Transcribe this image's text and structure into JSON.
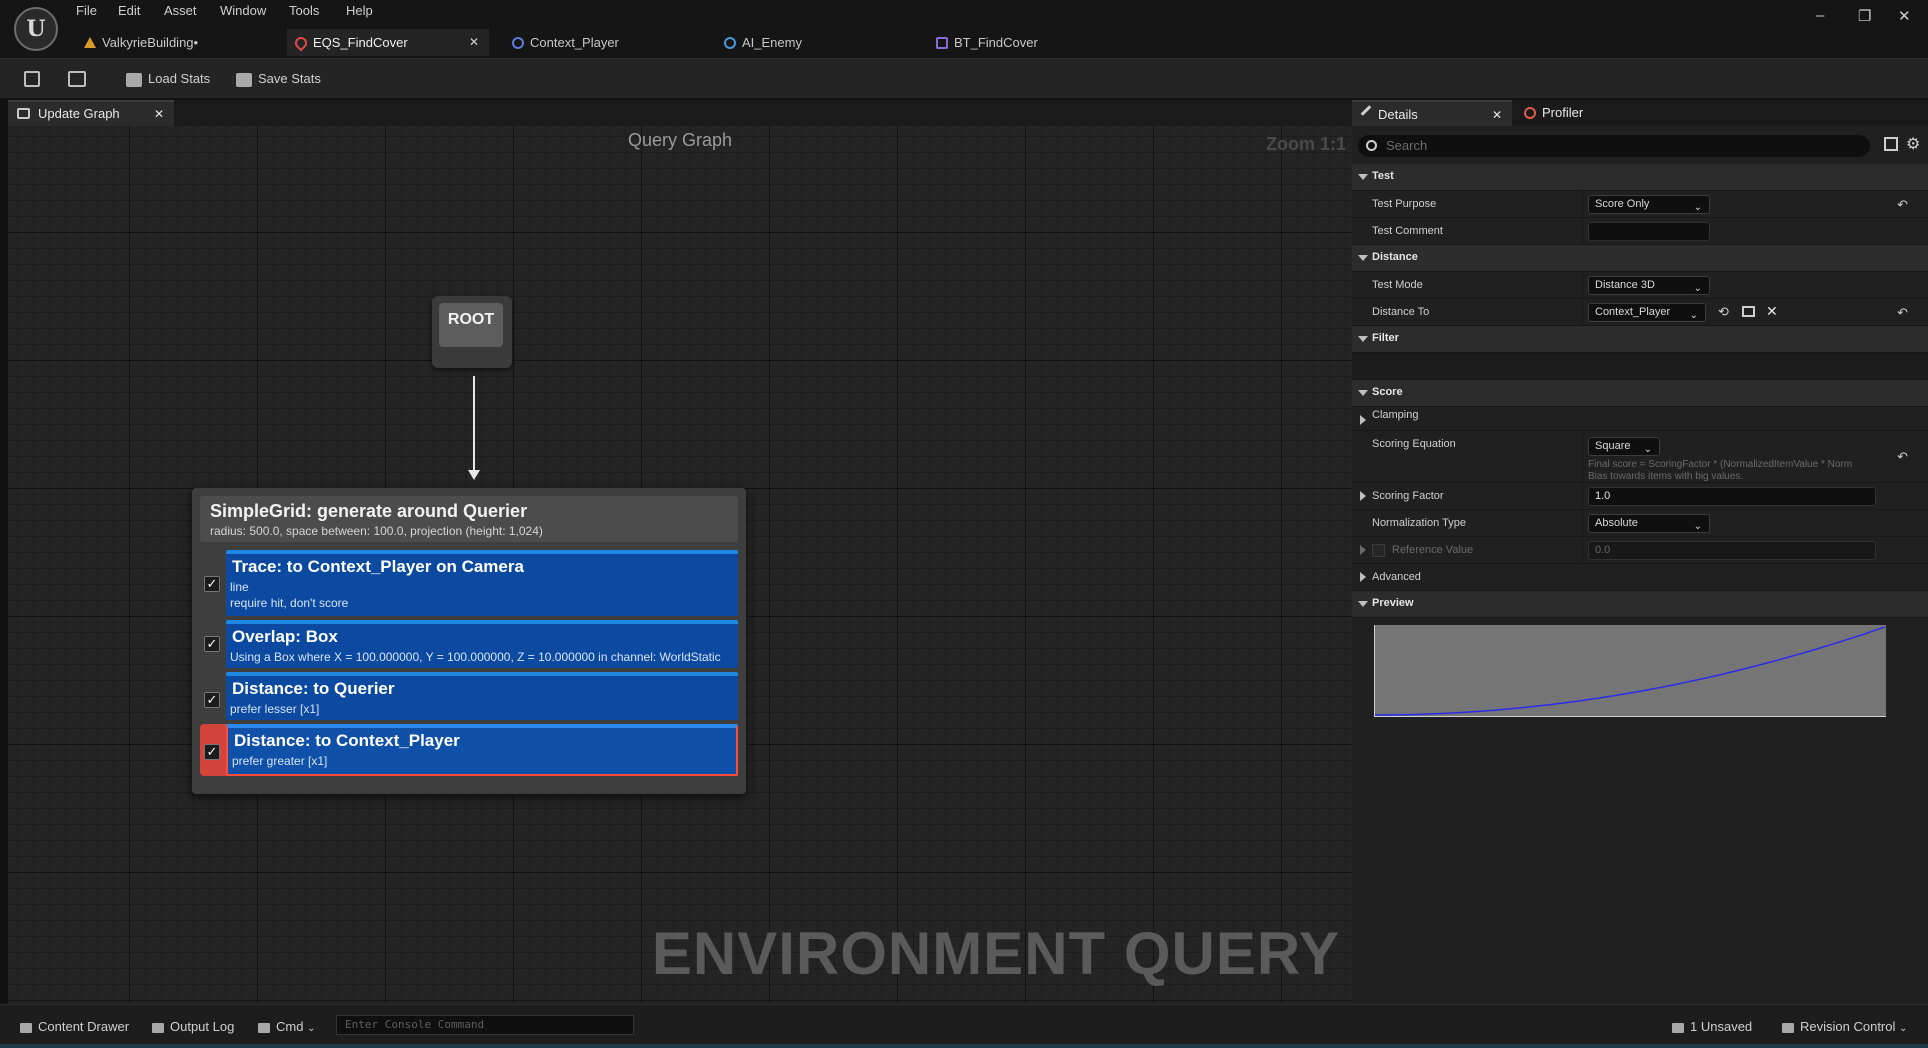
{
  "menu": [
    "File",
    "Edit",
    "Asset",
    "Window",
    "Tools",
    "Help"
  ],
  "doc_tabs": [
    {
      "label": "ValkyrieBuilding•",
      "icon": "level-icon",
      "color": "#d89a2c"
    },
    {
      "label": "EQS_FindCover",
      "icon": "eqs-icon",
      "color": "#e0484e",
      "active": true
    },
    {
      "label": "Context_Player",
      "icon": "blueprint-icon",
      "color": "#5c7be0"
    },
    {
      "label": "AI_Enemy",
      "icon": "blueprint-icon",
      "color": "#4a9ad8"
    },
    {
      "label": "BT_FindCover",
      "icon": "behavior-tree-icon",
      "color": "#8a6ad8"
    }
  ],
  "toolbar": {
    "load_stats": "Load Stats",
    "save_stats": "Save Stats"
  },
  "graph": {
    "tab_label": "Update Graph",
    "title": "Query Graph",
    "zoom": "Zoom 1:1",
    "watermark": "ENVIRONMENT QUERY",
    "root_label": "ROOT",
    "generator": {
      "title": "SimpleGrid: generate around Querier",
      "subtitle": "radius: 500.0, space between: 100.0, projection (height: 1,024)"
    },
    "tests": [
      {
        "title": "Trace: to Context_Player on Camera",
        "lines": [
          "line",
          "require hit, don't score"
        ],
        "checked": true
      },
      {
        "title": "Overlap: Box",
        "lines": [
          "Using a Box where X = 100.000000, Y = 100.000000, Z = 10.000000 in channel: WorldStatic"
        ],
        "checked": true
      },
      {
        "title": "Distance: to Querier",
        "lines": [
          "prefer lesser [x1]"
        ],
        "checked": true
      },
      {
        "title": "Distance: to Context_Player",
        "lines": [
          "prefer greater [x1]"
        ],
        "checked": true,
        "selected": true
      }
    ]
  },
  "details": {
    "tab_details": "Details",
    "tab_profiler": "Profiler",
    "search_placeholder": "Search",
    "cat_test": "Test",
    "test_purpose_label": "Test Purpose",
    "test_purpose_value": "Score Only",
    "test_comment_label": "Test Comment",
    "test_comment_value": "",
    "cat_distance": "Distance",
    "test_mode_label": "Test Mode",
    "test_mode_value": "Distance 3D",
    "distance_to_label": "Distance To",
    "distance_to_value": "Context_Player",
    "cat_filter": "Filter",
    "cat_score": "Score",
    "clamping_label": "Clamping",
    "scoring_eq_label": "Scoring Equation",
    "scoring_eq_value": "Square",
    "scoring_eq_hint1": "Final score = ScoringFactor * (NormalizedItemValue * Norm",
    "scoring_eq_hint2": "Bias towards items with big values.",
    "scoring_factor_label": "Scoring Factor",
    "scoring_factor_value": "1.0",
    "norm_type_label": "Normalization Type",
    "norm_type_value": "Absolute",
    "ref_value_label": "Reference Value",
    "ref_value_value": "0.0",
    "cat_advanced": "Advanced",
    "cat_preview": "Preview"
  },
  "status": {
    "content_drawer": "Content Drawer",
    "output_log": "Output Log",
    "cmd": "Cmd",
    "console_placeholder": "Enter Console Command",
    "unsaved": "1 Unsaved",
    "revision_control": "Revision Control"
  }
}
